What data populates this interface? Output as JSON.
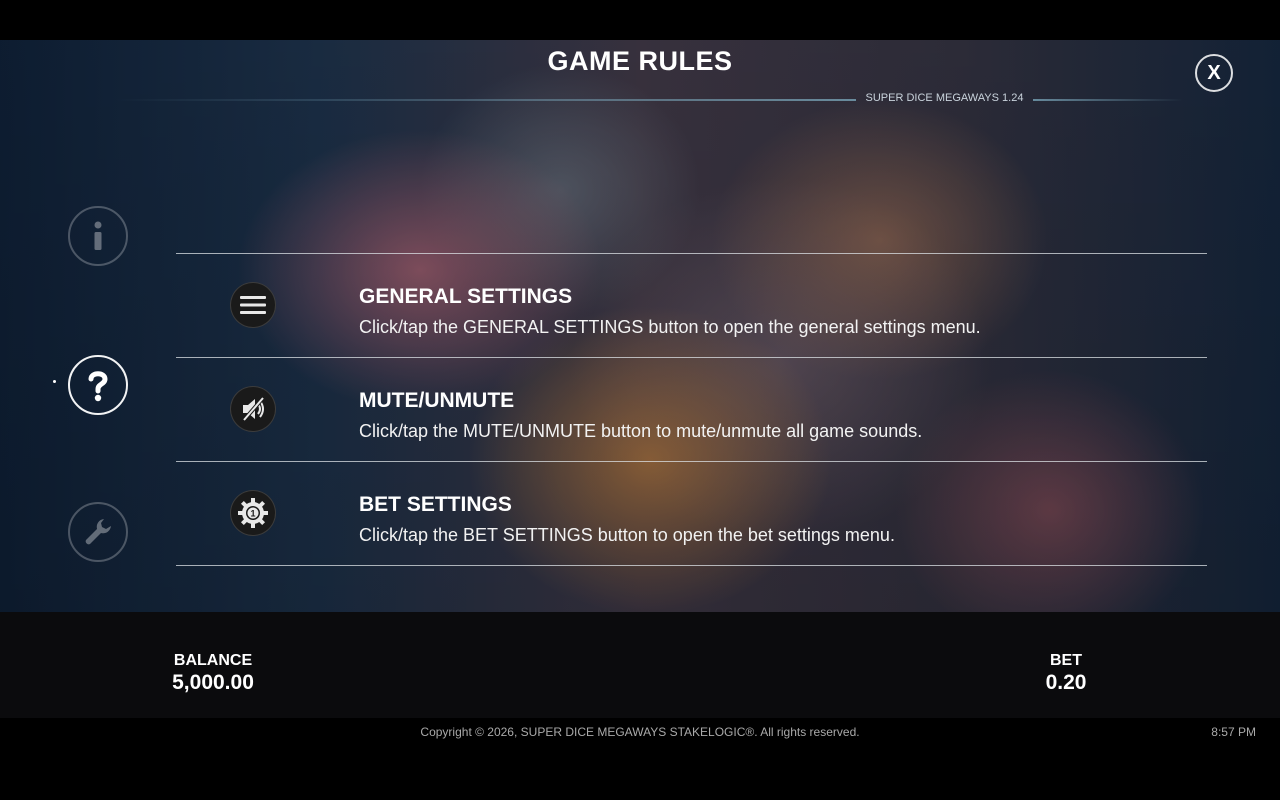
{
  "header": {
    "title": "GAME RULES",
    "version": "SUPER DICE MEGAWAYS 1.24",
    "close_label": "X"
  },
  "side_nav": {
    "items": [
      {
        "icon": "info-icon",
        "active": false
      },
      {
        "icon": "question-icon",
        "active": true
      },
      {
        "icon": "wrench-icon",
        "active": false
      }
    ]
  },
  "rules": [
    {
      "icon": "menu-icon",
      "title": "GENERAL SETTINGS",
      "description": "Click/tap the GENERAL SETTINGS button to open the general settings menu."
    },
    {
      "icon": "speaker-mute-icon",
      "title": "MUTE/UNMUTE",
      "description": "Click/tap the MUTE/UNMUTE button to mute/unmute all game sounds."
    },
    {
      "icon": "bet-gear-icon",
      "title": "BET SETTINGS",
      "description": "Click/tap the BET SETTINGS button to open the bet settings menu."
    }
  ],
  "bottom": {
    "balance_label": "BALANCE",
    "balance_value": "5,000.00",
    "bet_label": "BET",
    "bet_value": "0.20"
  },
  "footer": {
    "copyright": "Copyright © 2026, SUPER DICE MEGAWAYS STAKELOGIC®. All rights reserved.",
    "clock": "8:57 PM"
  }
}
